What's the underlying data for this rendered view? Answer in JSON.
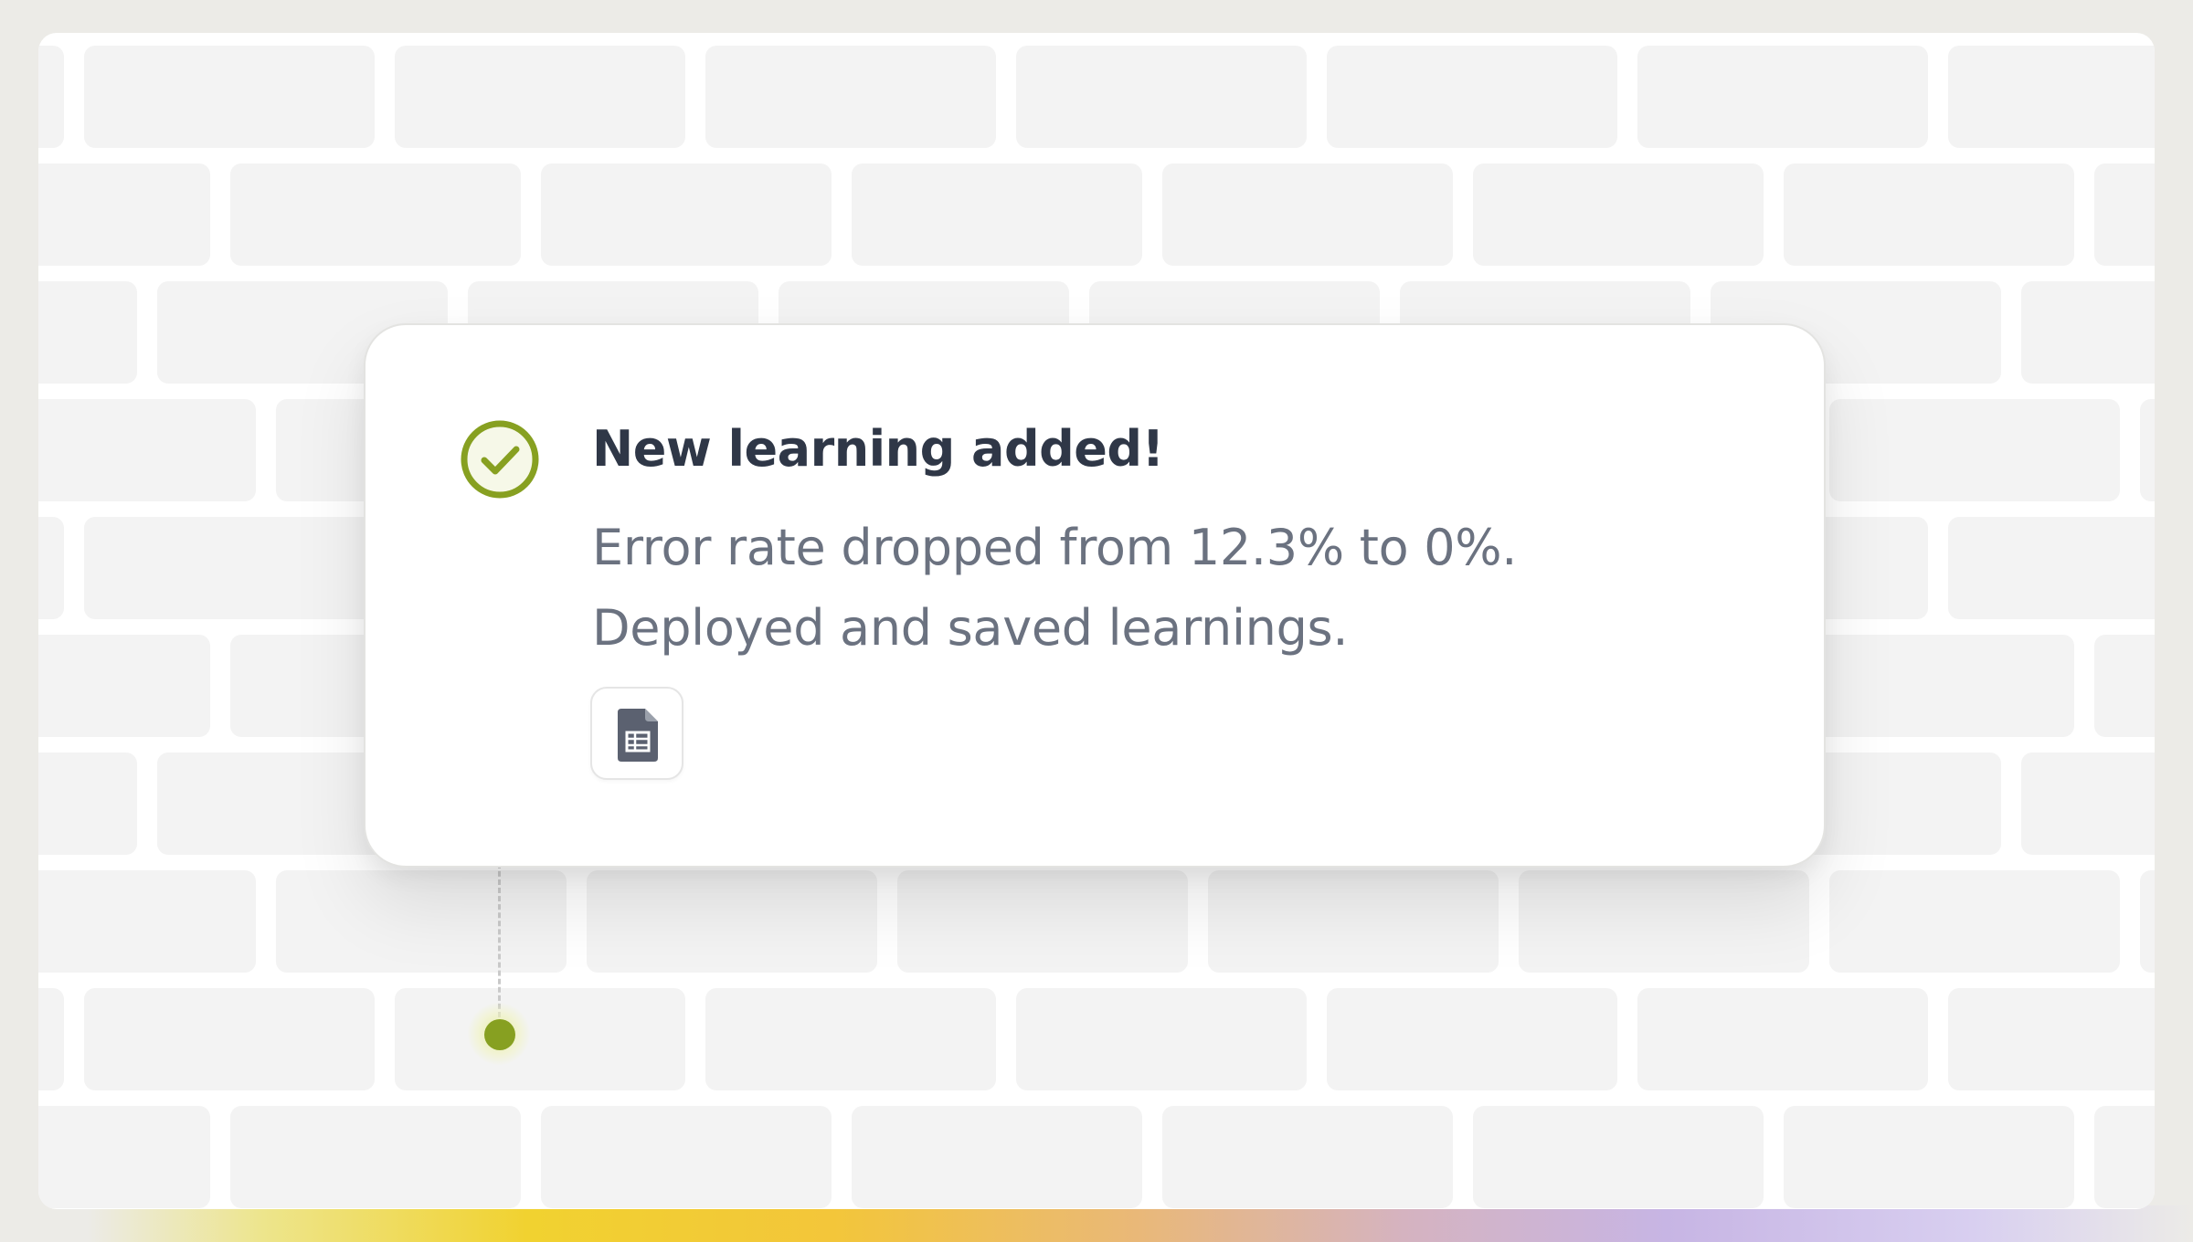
{
  "notification": {
    "title": "New learning added!",
    "description_line1": "Error rate dropped from 12.3% to 0%.",
    "description_line2": "Deployed and saved learnings.",
    "attachment_icon": "spreadsheet-file-icon",
    "status_icon": "check-circle-icon"
  },
  "colors": {
    "accent_green": "#87a021",
    "title_text": "#2f3747",
    "body_text": "#6b7280",
    "brick_fill": "#f3f3f3",
    "panel_background": "#ffffff"
  }
}
